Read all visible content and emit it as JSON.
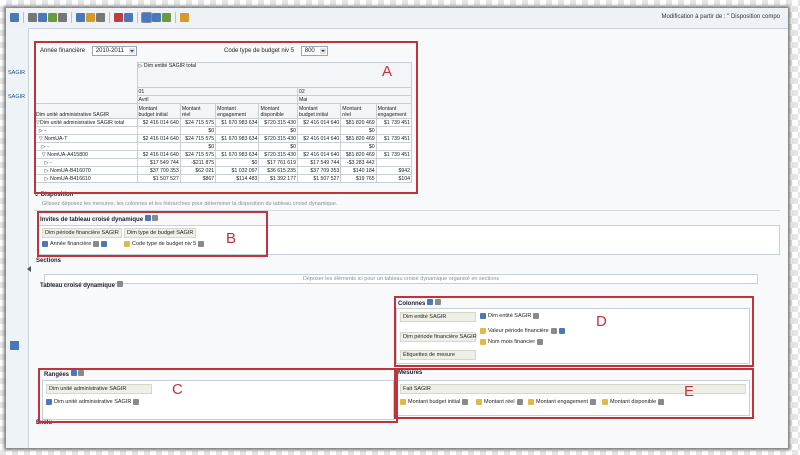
{
  "toolbar": {
    "breadcrumb": "Modification à partir de : \" Disposition compo"
  },
  "left_pane": {
    "items": [
      "SAGIR",
      "SAGIR"
    ]
  },
  "pivot": {
    "prompt_label": "Année financière",
    "prompt_value": "2010-2011",
    "budget_code_label": "Code type de budget niv 5",
    "budget_code_value": "800",
    "entity_header": "▷ Dim entité SAGIR total",
    "period1_code": "01",
    "period1_name": "Avril",
    "period2_code": "02",
    "period2_name": "Mai",
    "row_dim_label": "Dim unité administrative SAGIR",
    "measure_headers": [
      "Montant\nbudget initial",
      "Montant\nréel",
      "Montant\nengagement",
      "Montant\ndisponible",
      "Montant\nbudget initial",
      "Montant\nréel",
      "Montant\nengagement"
    ],
    "rows": [
      {
        "label": "▽Dim unité administrative SAGIR total",
        "values": [
          "$2 416 014 640",
          "$24 715 575",
          "$1 670 983 634",
          "$720 315 430",
          "$2 416 014 640",
          "$81 820 469",
          "$1 739 451"
        ]
      },
      {
        "label": "  ▷ -",
        "values": [
          "",
          "$0",
          "",
          "$0",
          "",
          "$0",
          ""
        ]
      },
      {
        "label": "  ▽ NomUA-T",
        "values": [
          "$2 416 014 640",
          "$24 715 575",
          "$1 670 983 634",
          "$720 315 430",
          "$2 416 014 640",
          "$81 820 469",
          "$1 739 451"
        ]
      },
      {
        "label": "    ▷ -",
        "values": [
          "",
          "$0",
          "",
          "$0",
          "",
          "$0",
          ""
        ]
      },
      {
        "label": "    ▽ NomUA-A415800",
        "values": [
          "$2 416 014 640",
          "$24 715 575",
          "$1 670 983 634",
          "$720 315 430",
          "$2 416 014 640",
          "$81 820 469",
          "$1 739 451"
        ]
      },
      {
        "label": "      ▷ -",
        "values": [
          "$17 549 744",
          "-$211 875",
          "$0",
          "$17 761 619",
          "$17 549 744",
          "-$3 283 442",
          ""
        ]
      },
      {
        "label": "      ▷ NomUA-B416070",
        "values": [
          "$37 709 353",
          "$62 021",
          "$1 032 097",
          "$36 615 235",
          "$37 709 353",
          "$140 184",
          "$942"
        ]
      },
      {
        "label": "      ▷ NomUA-B416610",
        "values": [
          "$1 507 527",
          "$867",
          "$114 483",
          "$1 392 177",
          "$1 507 527",
          "$19 765",
          "$104"
        ]
      }
    ]
  },
  "disposition": {
    "title": "Disposition",
    "hint": "Glissez déposez les mesures, les colonnes et les hiérarchies pour déterminer la disposition du tableau croisé dynamique.",
    "invites_title": "Invites de tableau croisé dynamique",
    "invites_chips": [
      "Dim période financière SAGIR",
      "Dim type de budget SAGIR"
    ],
    "invites_items": [
      "Année financière",
      "Code type de budget niv 5"
    ],
    "sections_title": "Sections",
    "sections_drop_hint": "Déposer les éléments ici pour un tableau croisé dynamique organisé en sections",
    "pivot_title": "Tableau croisé dynamique",
    "columns_title": "Colonnes",
    "columns_rows": [
      {
        "dim": "Dim entité SAGIR",
        "items": [
          "Dim entité SAGIR"
        ]
      },
      {
        "dim": "Dim période financière SAGIR",
        "items": [
          "Valeur période financière",
          "Nom mois financier"
        ]
      },
      {
        "dim": "Étiquettes de mesure",
        "items": []
      }
    ],
    "rows_title": "Rangées",
    "rows_dim": "Dim unité administrative SAGIR",
    "rows_item": "Dim unité administrative SAGIR",
    "measures_title": "Mesures",
    "measures_fact": "Fait SAGIR",
    "measures_items": [
      "Montant budget initial",
      "Montant réel",
      "Montant engagement",
      "Montant disponible"
    ],
    "excluded_title": "Exclu"
  },
  "annotations": [
    "A",
    "B",
    "C",
    "D",
    "E"
  ],
  "colors": {
    "annotation_red": "#c0333a",
    "toolbar_bg": "#eef1f5"
  }
}
